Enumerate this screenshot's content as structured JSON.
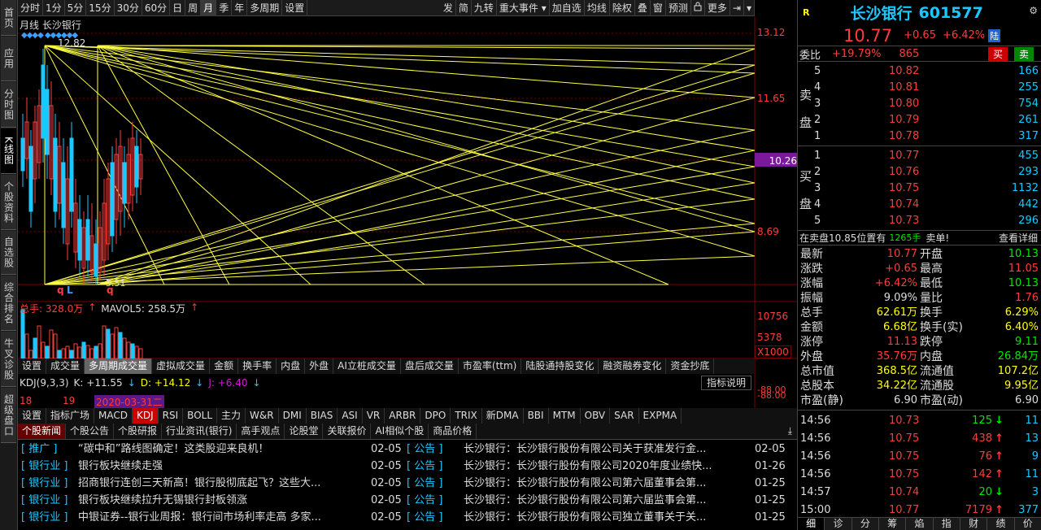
{
  "left_nav": [
    "首页",
    "应用",
    "分时图",
    "K线图",
    "个股资料",
    "自选股",
    "综合排名",
    "牛叉诊股",
    "超级盘口"
  ],
  "toolbar": {
    "left": [
      "分时",
      "1分",
      "5分",
      "15分",
      "30分",
      "60分",
      "日",
      "周",
      "月",
      "季",
      "年",
      "多周期",
      "设置"
    ],
    "right": [
      "发",
      "简",
      "九转",
      "重大事件",
      "加自选",
      "均线",
      "除权",
      "叠",
      "窗",
      "预测",
      "锁",
      "更多"
    ],
    "active": "月"
  },
  "chart": {
    "label": "月线  长沙银行",
    "price_labels": [
      "13.12",
      "11.65",
      "10.26",
      "8.69"
    ],
    "high_marker": "12.82",
    "low_marker": "5.51",
    "bottom_marks": [
      "q",
      "L",
      "q"
    ]
  },
  "volume": {
    "label": "总手: 328.0万",
    "mavol": "MAVOL5: 258.5万",
    "axis": [
      "10756",
      "5378",
      "X1000"
    ]
  },
  "vol_tabs": [
    "设置",
    "成交量",
    "多周期成交量",
    "虚拟成交量",
    "金额",
    "换手率",
    "内盘",
    "外盘",
    "AI立桩成交量",
    "盘后成交量",
    "市盈率(ttm)",
    "陆股通持股变化",
    "融资融券变化",
    "资金抄底"
  ],
  "vol_tab_active": "多周期成交量",
  "indicator_btn": "指标说明",
  "kdj": {
    "label": "KDJ(9,3,3)",
    "k": "K: +11.55",
    "d": "D: +14.12",
    "j": "J: +6.40",
    "axis": [
      "-88.00",
      "-88.00"
    ]
  },
  "time_axis": [
    "18",
    "19",
    "2020-03-31二"
  ],
  "ind_tabs": [
    "设置",
    "指标广场",
    "MACD",
    "KDJ",
    "RSI",
    "BOLL",
    "主力",
    "W&R",
    "DMI",
    "BIAS",
    "ASI",
    "VR",
    "ARBR",
    "DPO",
    "TRIX",
    "新DMA",
    "BBI",
    "MTM",
    "OBV",
    "SAR",
    "EXPMA"
  ],
  "ind_tab_active": "KDJ",
  "news_tabs": [
    "个股新闻",
    "个股公告",
    "个股研报",
    "行业资讯(银行)",
    "高手观点",
    "论股堂",
    "关联报价",
    "AI相似个股",
    "商品价格"
  ],
  "news_left": [
    {
      "tag": "推广",
      "title": "“碳中和”路线图确定！这类股迎来良机！",
      "date": "02-05"
    },
    {
      "tag": "银行业",
      "title": "银行板块继续走强",
      "date": "02-05"
    },
    {
      "tag": "银行业",
      "title": "招商银行连创三天新高！银行股彻底起飞？这些大...",
      "date": "02-05"
    },
    {
      "tag": "银行业",
      "title": "银行板块继续拉升无锡银行封板领涨",
      "date": "02-05"
    },
    {
      "tag": "银行业",
      "title": "中银证券--银行业周报：银行间市场利率走高 多家...",
      "date": "02-05"
    }
  ],
  "news_right": [
    {
      "tag": "公告",
      "title": "长沙银行：长沙银行股份有限公司关于获准发行金...",
      "date": "02-05"
    },
    {
      "tag": "公告",
      "title": "长沙银行：长沙银行股份有限公司2020年度业绩快...",
      "date": "01-26"
    },
    {
      "tag": "公告",
      "title": "长沙银行：长沙银行股份有限公司第六届董事会第...",
      "date": "01-25"
    },
    {
      "tag": "公告",
      "title": "长沙银行：长沙银行股份有限公司第六届监事会第...",
      "date": "01-25"
    },
    {
      "tag": "公告",
      "title": "长沙银行：长沙银行股份有限公司独立董事关于关...",
      "date": "01-25"
    }
  ],
  "quote": {
    "badge": "R",
    "name": "长沙银行",
    "code": "601577",
    "price": "10.77",
    "change": "+0.65",
    "pct": "+6.42%",
    "lu": "陆",
    "weibi_label": "委比",
    "weibi": "+19.79%",
    "weicha": "865",
    "buy_btn": "买",
    "sell_btn": "卖",
    "sell_side": "卖盘",
    "buy_side": "买盘",
    "asks": [
      {
        "lv": "5",
        "price": "10.82",
        "vol": "166"
      },
      {
        "lv": "4",
        "price": "10.81",
        "vol": "255"
      },
      {
        "lv": "3",
        "price": "10.80",
        "vol": "754"
      },
      {
        "lv": "2",
        "price": "10.79",
        "vol": "261"
      },
      {
        "lv": "1",
        "price": "10.78",
        "vol": "317"
      }
    ],
    "bids": [
      {
        "lv": "1",
        "price": "10.77",
        "vol": "455"
      },
      {
        "lv": "2",
        "price": "10.76",
        "vol": "293"
      },
      {
        "lv": "3",
        "price": "10.75",
        "vol": "1132"
      },
      {
        "lv": "4",
        "price": "10.74",
        "vol": "442"
      },
      {
        "lv": "5",
        "price": "10.73",
        "vol": "296"
      }
    ],
    "alert_a": "在卖盘10.85位置有",
    "alert_b": "1265手",
    "alert_c": "卖单!",
    "alert_link": "查看详细",
    "stats": [
      {
        "l1": "最新",
        "v1": "10.77",
        "c1": "red",
        "l2": "开盘",
        "v2": "10.13",
        "c2": "grn"
      },
      {
        "l1": "涨跌",
        "v1": "+0.65",
        "c1": "red",
        "l2": "最高",
        "v2": "11.05",
        "c2": "red"
      },
      {
        "l1": "涨幅",
        "v1": "+6.42%",
        "c1": "red",
        "l2": "最低",
        "v2": "10.13",
        "c2": "grn"
      },
      {
        "l1": "振幅",
        "v1": "9.09%",
        "c1": "wht",
        "l2": "量比",
        "v2": "1.76",
        "c2": "red"
      },
      {
        "l1": "总手",
        "v1": "62.61万",
        "c1": "yel",
        "l2": "换手",
        "v2": "6.29%",
        "c2": "yel"
      },
      {
        "l1": "金额",
        "v1": "6.68亿",
        "c1": "yel",
        "l2": "换手(实)",
        "v2": "6.40%",
        "c2": "yel"
      },
      {
        "l1": "涨停",
        "v1": "11.13",
        "c1": "red",
        "l2": "跌停",
        "v2": "9.11",
        "c2": "grn"
      },
      {
        "l1": "外盘",
        "v1": "35.76万",
        "c1": "red",
        "l2": "内盘",
        "v2": "26.84万",
        "c2": "grn"
      },
      {
        "l1": "总市值",
        "v1": "368.5亿",
        "c1": "yel",
        "l2": "流通值",
        "v2": "107.2亿",
        "c2": "yel"
      },
      {
        "l1": "总股本",
        "v1": "34.22亿",
        "c1": "yel",
        "l2": "流通股",
        "v2": "9.95亿",
        "c2": "yel"
      },
      {
        "l1": "市盈(静)",
        "v1": "6.90",
        "c1": "wht",
        "l2": "市盈(动)",
        "v2": "6.90",
        "c2": "wht"
      }
    ],
    "ticks": [
      {
        "t": "14:56",
        "p": "10.73",
        "pc": "red",
        "v": "125",
        "vc": "grn",
        "dir": "down",
        "n": "11"
      },
      {
        "t": "14:56",
        "p": "10.75",
        "pc": "red",
        "v": "438",
        "vc": "red",
        "dir": "up",
        "n": "13"
      },
      {
        "t": "14:56",
        "p": "10.75",
        "pc": "red",
        "v": "76",
        "vc": "red",
        "dir": "up",
        "n": "9"
      },
      {
        "t": "14:56",
        "p": "10.75",
        "pc": "red",
        "v": "142",
        "vc": "red",
        "dir": "up",
        "n": "11"
      },
      {
        "t": "14:57",
        "p": "10.74",
        "pc": "red",
        "v": "20",
        "vc": "grn",
        "dir": "down",
        "n": "3"
      },
      {
        "t": "15:00",
        "p": "10.77",
        "pc": "red",
        "v": "7179",
        "vc": "red",
        "dir": "up",
        "n": "377"
      }
    ],
    "bottom_tabs": [
      "细",
      "诊",
      "分",
      "筹",
      "焰",
      "指",
      "财",
      "绩",
      "价"
    ]
  },
  "colors": {
    "up": "#ff3b3b",
    "down": "#00e600",
    "accent": "#ffff00",
    "name": "#19c8ff"
  }
}
